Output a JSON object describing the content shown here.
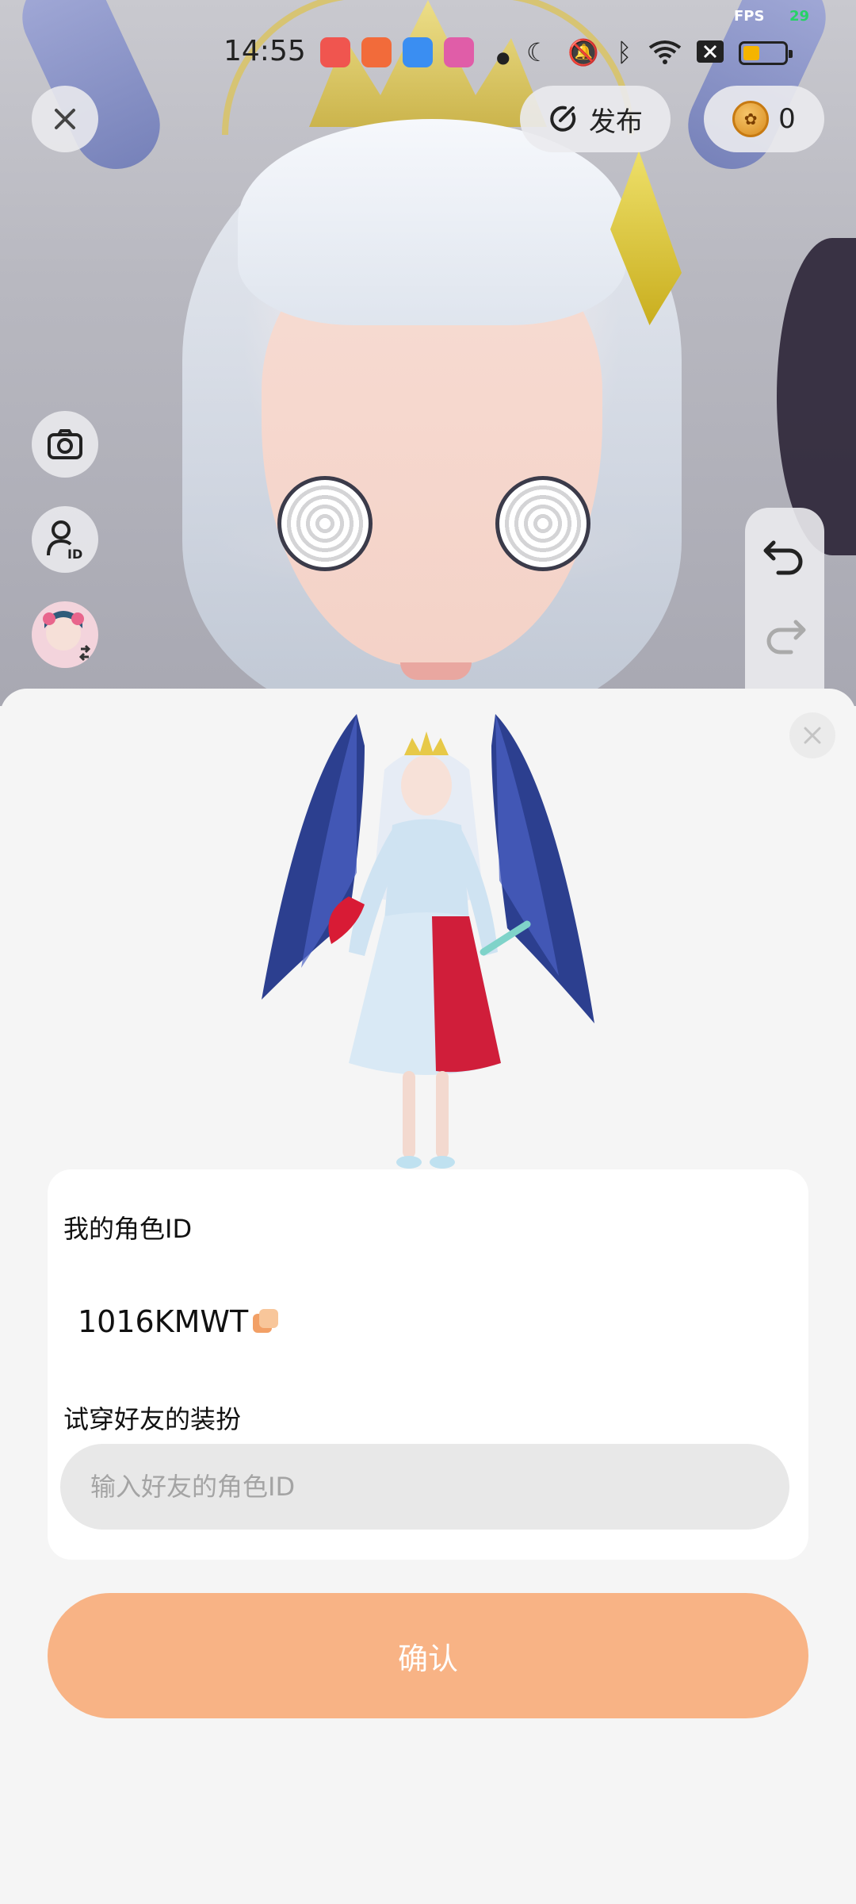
{
  "status_bar": {
    "time": "14:55",
    "fps_label": "FPS",
    "fps_value": "29"
  },
  "toolbar": {
    "publish_label": "发布",
    "coins": "0"
  },
  "sheet": {
    "my_id_label": "我的角色ID",
    "my_id_value": "1016KMWT",
    "try_friend_label": "试穿好友的装扮",
    "friend_id_placeholder": "输入好友的角色ID",
    "confirm_label": "确认"
  },
  "colors": {
    "accent": "#f8b385",
    "input_bg": "#e8e8e8",
    "sheet_bg": "#f5f5f5"
  }
}
